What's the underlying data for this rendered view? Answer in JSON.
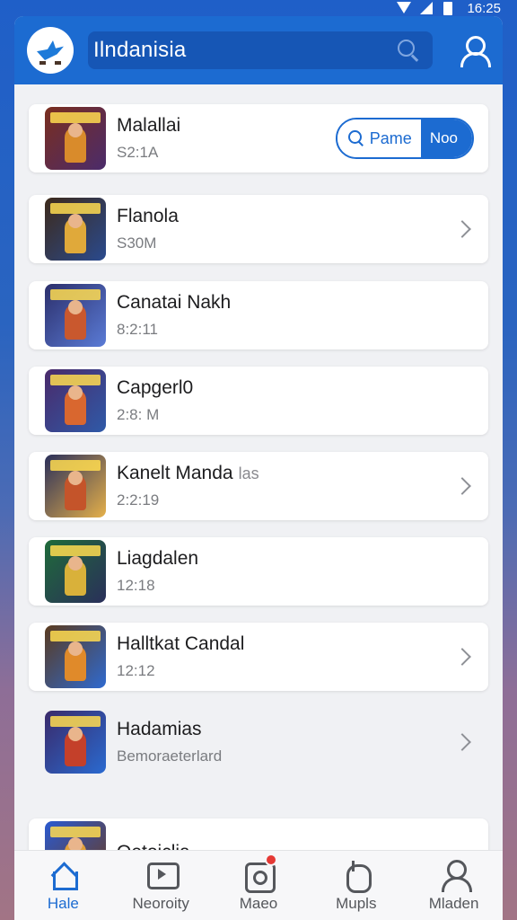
{
  "status_bar": {
    "time": "16:25",
    "icons": [
      "wifi-icon",
      "signal-icon",
      "battery-icon"
    ]
  },
  "header": {
    "search_text": "Ilndanisia",
    "logo": "bird-logo-icon"
  },
  "colors": {
    "accent": "#1c6bd1",
    "background": "#f0f1f4",
    "card": "#ffffff"
  },
  "games": [
    {
      "name": "Malallai",
      "suffix": "",
      "sub": "S2:1A",
      "action": "pill",
      "thumb": [
        "#7a2e1e",
        "#d98b2b",
        "#4b2b6b"
      ]
    },
    {
      "name": "Flanola",
      "suffix": "",
      "sub": "S30M",
      "action": "chevron",
      "thumb": [
        "#3d2a1a",
        "#e0a93a",
        "#2a4a8e"
      ]
    },
    {
      "name": "Canatai Nakh",
      "suffix": "",
      "sub": "8:2:11",
      "action": "none",
      "thumb": [
        "#2c2f6b",
        "#c9582e",
        "#5a7bd6"
      ]
    },
    {
      "name": "Capgerl0",
      "suffix": "",
      "sub": "2:8: M",
      "action": "none",
      "thumb": [
        "#4a2a6a",
        "#d9672f",
        "#2f5aa8"
      ]
    },
    {
      "name": "Kanelt Manda",
      "suffix": "las",
      "sub": "2:2:19",
      "action": "chevron",
      "thumb": [
        "#2a2f5a",
        "#c4542a",
        "#e5b04a"
      ]
    },
    {
      "name": "Liagdalen",
      "suffix": "",
      "sub": "12:18",
      "action": "none",
      "thumb": [
        "#1f6b3a",
        "#d9b13a",
        "#2a2f5a"
      ]
    },
    {
      "name": "Halltkat Candal",
      "suffix": "",
      "sub": "12:12",
      "action": "chevron",
      "thumb": [
        "#5a3a1e",
        "#e08a2a",
        "#2f6ad0"
      ]
    },
    {
      "name": "Hadamias",
      "suffix": "",
      "sub": "Bemoraeterlard",
      "action": "chevron",
      "thumb": [
        "#3a2a6a",
        "#c4402a",
        "#2a6ad0"
      ]
    },
    {
      "name": "Oetoiclia",
      "suffix": "",
      "sub": "",
      "action": "badge",
      "thumb": [
        "#2a5ad0",
        "#e0a03a",
        "#6a3a1e"
      ]
    }
  ],
  "pill": {
    "left_label": "Pame",
    "right_label": "Noo"
  },
  "tabs": [
    {
      "label": "Hale",
      "icon": "home-icon",
      "active": true
    },
    {
      "label": "Neoroity",
      "icon": "media-icon",
      "active": false
    },
    {
      "label": "Maeo",
      "icon": "message-icon",
      "active": false
    },
    {
      "label": "Mupls",
      "icon": "hand-icon",
      "active": false
    },
    {
      "label": "Mladen",
      "icon": "user-icon",
      "active": false
    }
  ]
}
